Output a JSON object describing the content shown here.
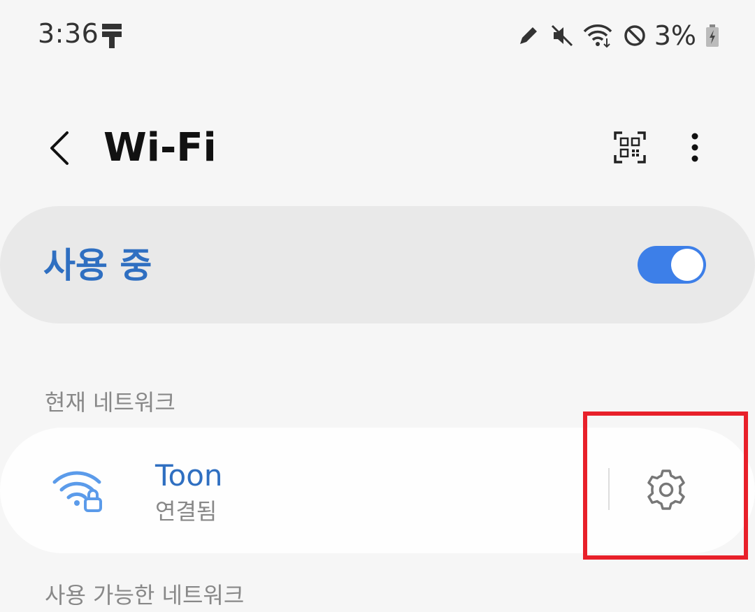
{
  "status_bar": {
    "time": "3:36",
    "battery": "3%",
    "icons": [
      "app-notification-icon",
      "pen-icon",
      "mute-icon",
      "wifi-data-icon",
      "do-not-disturb-icon",
      "battery-charging-icon"
    ]
  },
  "app_bar": {
    "title": "Wi-Fi",
    "back_icon": "chevron-left-icon",
    "qr_icon": "qr-scanner-icon",
    "more_icon": "more-vert-icon"
  },
  "master_toggle": {
    "label": "사용 중",
    "state": "on"
  },
  "sections": {
    "current_network": "현재 네트워크",
    "available_networks": "사용 가능한 네트워크"
  },
  "current_network": {
    "name": "Toon",
    "status": "연결됨",
    "icon": "wifi-secured-icon",
    "settings_icon": "gear-icon"
  },
  "colors": {
    "accent": "#2f6fc1",
    "toggle_on": "#3d7fe8",
    "highlight": "#e8202a",
    "background": "#f6f6f6"
  }
}
